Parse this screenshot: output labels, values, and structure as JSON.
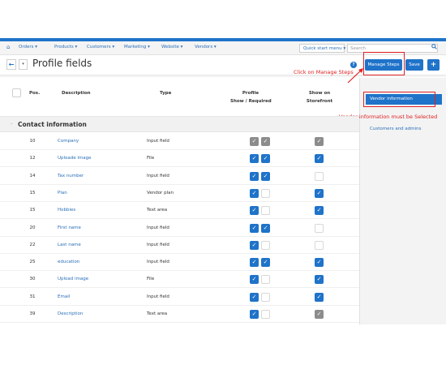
{
  "nav": {
    "home_icon": "home-icon",
    "items": [
      "Orders ▾",
      "Products ▾",
      "Customers ▾",
      "Marketing ▾",
      "Website ▾",
      "Vendors ▾"
    ],
    "quick_start": "Quick start menu ▾",
    "search_placeholder": "Search",
    "search_icon": "search-icon"
  },
  "title_bar": {
    "back_glyph": "←",
    "dropdown_glyph": "▾",
    "title": "Profile fields",
    "help_glyph": "?",
    "manage_steps": "Manage Steps",
    "save": "Save",
    "add": "+"
  },
  "annotations": {
    "manage_steps_note": "Click on Manage Steps",
    "vendor_note": "Vendor information must be Selected",
    "color": "#e02020"
  },
  "sidebar": {
    "link": "Customers and admins",
    "active": "Vendor information"
  },
  "table": {
    "headers": {
      "pos": "Pos.",
      "description": "Description",
      "type": "Type",
      "profile_1": "Profile",
      "profile_2": "Show / Required",
      "storefront_1": "Show on",
      "storefront_2": "Storefront"
    },
    "section": "Contact information",
    "rows": [
      {
        "pos": "10",
        "description": "Company",
        "type": "Input field",
        "show": "disabled",
        "required": "disabled",
        "storefront": "disabled"
      },
      {
        "pos": "12",
        "description": "Uploade image",
        "type": "File",
        "show": "on",
        "required": "on",
        "storefront": "on"
      },
      {
        "pos": "14",
        "description": "Tax number",
        "type": "Input field",
        "show": "on",
        "required": "on",
        "storefront": "off"
      },
      {
        "pos": "15",
        "description": "Plan",
        "type": "Vendor plan",
        "show": "on",
        "required": "off",
        "storefront": "on"
      },
      {
        "pos": "15",
        "description": "Hobbies",
        "type": "Text area",
        "show": "on",
        "required": "off",
        "storefront": "on"
      },
      {
        "pos": "20",
        "description": "First name",
        "type": "Input field",
        "show": "on",
        "required": "on",
        "storefront": "off"
      },
      {
        "pos": "22",
        "description": "Last name",
        "type": "Input field",
        "show": "on",
        "required": "off",
        "storefront": "off"
      },
      {
        "pos": "25",
        "description": "education",
        "type": "Input field",
        "show": "on",
        "required": "on",
        "storefront": "on"
      },
      {
        "pos": "30",
        "description": "Upload image",
        "type": "File",
        "show": "on",
        "required": "off",
        "storefront": "on"
      },
      {
        "pos": "31",
        "description": "Email",
        "type": "Input field",
        "show": "on",
        "required": "off",
        "storefront": "on"
      },
      {
        "pos": "39",
        "description": "Description",
        "type": "Text area",
        "show": "on",
        "required": "off",
        "storefront": "disabled"
      }
    ]
  },
  "colors": {
    "accent": "#1f73c9",
    "link": "#2a6fb8",
    "disabled_check": "#8c8c8c",
    "highlight": "#e02020"
  }
}
